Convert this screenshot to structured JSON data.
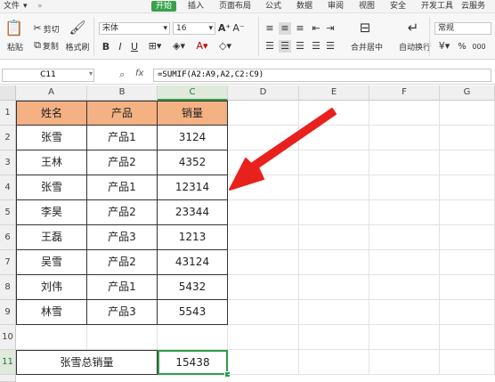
{
  "menu": {
    "items": [
      "文件",
      "开始",
      "插入",
      "页面布局",
      "公式",
      "数据",
      "审阅",
      "视图",
      "安全",
      "开发工具",
      "云服务"
    ],
    "active_index": 1
  },
  "ribbon": {
    "paste": "粘贴",
    "cut": "剪切",
    "copy": "复制",
    "format_painter": "格式刷",
    "font_name": "宋体",
    "font_size": "16",
    "bold": "B",
    "italic": "I",
    "underline": "U",
    "merge_center": "合并居中",
    "wrap_text": "自动换行",
    "number_format": "常规",
    "percent": "%",
    "thousands": "000"
  },
  "formula_bar": {
    "name_box": "C11",
    "fx": "fx",
    "formula": "=SUMIF(A2:A9,A2,C2:C9)"
  },
  "columns": [
    "A",
    "B",
    "C",
    "D",
    "E",
    "F",
    "G"
  ],
  "rows": [
    "1",
    "2",
    "3",
    "4",
    "5",
    "6",
    "7",
    "8",
    "9",
    "10",
    "11"
  ],
  "table": {
    "headers": [
      "姓名",
      "产品",
      "销量"
    ],
    "rows": [
      [
        "张雪",
        "产品1",
        "3124"
      ],
      [
        "王林",
        "产品2",
        "4352"
      ],
      [
        "张雪",
        "产品1",
        "12314"
      ],
      [
        "李昊",
        "产品2",
        "23344"
      ],
      [
        "王磊",
        "产品3",
        "1213"
      ],
      [
        "吴雪",
        "产品2",
        "43124"
      ],
      [
        "刘伟",
        "产品1",
        "5432"
      ],
      [
        "林雪",
        "产品3",
        "5543"
      ]
    ],
    "header_color": "#f4b183"
  },
  "summary": {
    "label": "张雪总销量",
    "value": "15438"
  },
  "colors": {
    "accent": "#3aa14b",
    "arrow": "#e8211d",
    "selection": "#2f9e48"
  }
}
